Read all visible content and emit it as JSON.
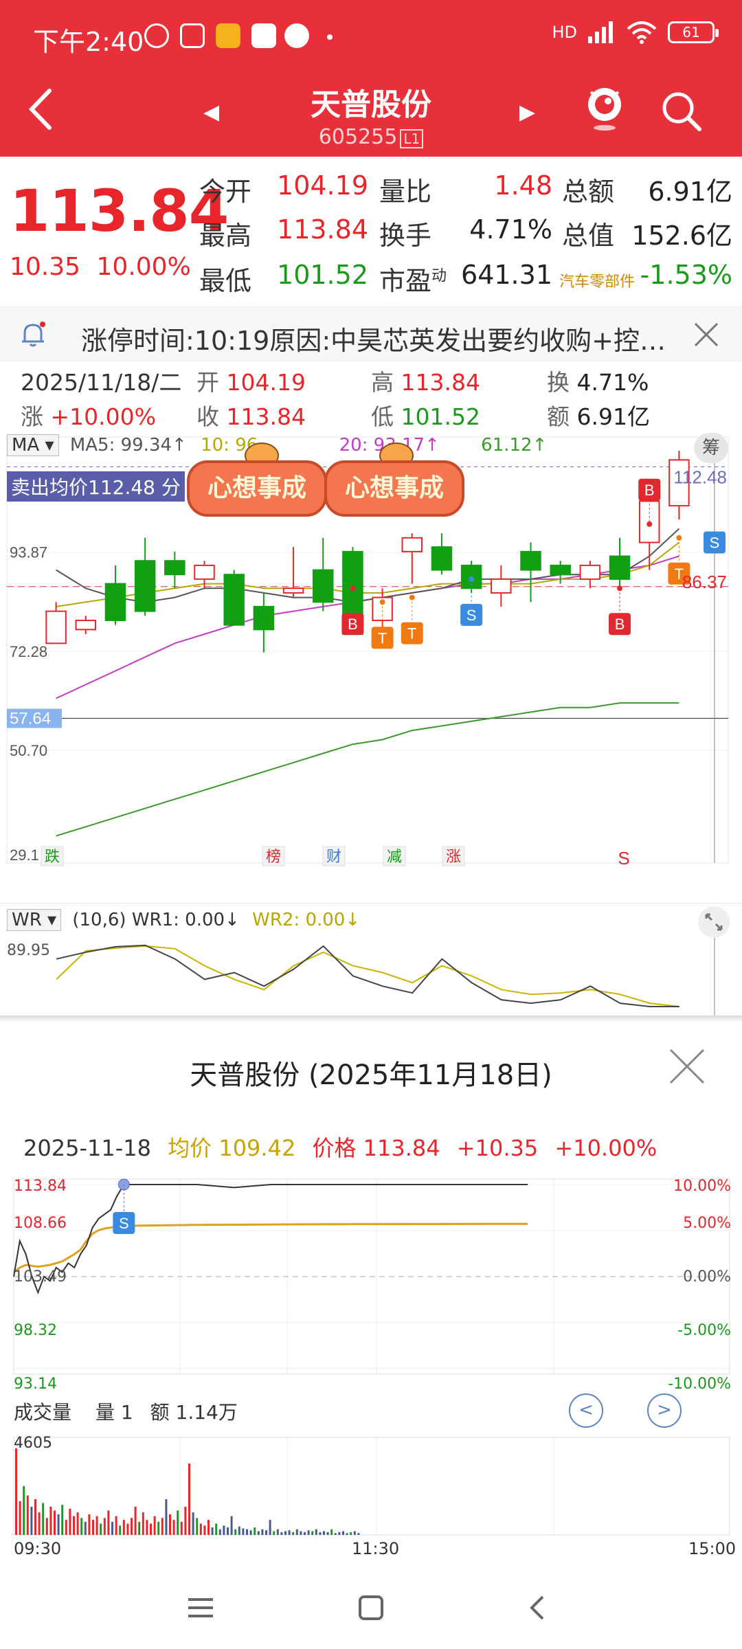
{
  "status": {
    "time": "下午2:40",
    "signal": "HD",
    "battery": "61"
  },
  "header": {
    "title": "天普股份",
    "code": "605255",
    "code_tag": "L1"
  },
  "quote": {
    "price": "113.84",
    "change": "10.35",
    "change_pct": "10.00%",
    "rows": [
      {
        "l1": "今开",
        "v1": "104.19",
        "l2": "量比",
        "v2": "1.48",
        "l3": "总额",
        "v3": "6.91亿"
      },
      {
        "l1": "最高",
        "v1": "113.84",
        "l2": "换手",
        "v2": "4.71%",
        "l3": "总值",
        "v3": "152.6亿"
      },
      {
        "l1": "最低",
        "v1": "101.52",
        "l2": "市盈",
        "l2_sup": "动",
        "v2": "641.31",
        "l3": "汽车零部件",
        "v3": "-1.53%"
      }
    ]
  },
  "notice": {
    "text": "涨停时间:10:19原因:中昊芯英发出要约收购+控…"
  },
  "day": {
    "date": "2025/11/18/二",
    "open_l": "开",
    "open_v": "104.19",
    "high_l": "高",
    "high_v": "113.84",
    "turn_l": "换",
    "turn_v": "4.71%",
    "chg_l": "涨",
    "chg_v": "+10.00%",
    "close_l": "收",
    "close_v": "113.84",
    "low_l": "低",
    "low_v": "101.52",
    "amt_l": "额",
    "amt_v": "6.91亿"
  },
  "kchart": {
    "indicator": "MA",
    "ma5": "MA5: 99.34↑",
    "ma10": "10: 96",
    "ma20": "20: 93.17↑",
    "ma60": "61.12↑",
    "chip_btn": "筹",
    "sell_avg": "卖出均价112.48 分",
    "sticker": "心想事成",
    "price_right": "112.48",
    "price_right2": "86.37",
    "axis": [
      "93.87",
      "72.28",
      "57.64",
      "50.70",
      "29.1"
    ],
    "events": [
      "跌",
      "榜",
      "财",
      "减",
      "涨",
      "S"
    ],
    "markers": {
      "B": "B",
      "T": "T",
      "S": "S"
    },
    "chart_data": {
      "type": "candlestick",
      "ylim": [
        29.1,
        116
      ],
      "candles": [
        {
          "o": 74,
          "c": 81,
          "h": 83,
          "l": 74
        },
        {
          "o": 77,
          "c": 79,
          "h": 80,
          "l": 76
        },
        {
          "o": 87,
          "c": 79,
          "h": 91,
          "l": 78
        },
        {
          "o": 92,
          "c": 81,
          "h": 97,
          "l": 80
        },
        {
          "o": 92,
          "c": 89,
          "h": 94,
          "l": 86
        },
        {
          "o": 88,
          "c": 91,
          "h": 92,
          "l": 86
        },
        {
          "o": 89,
          "c": 78,
          "h": 90,
          "l": 78
        },
        {
          "o": 82,
          "c": 77,
          "h": 85,
          "l": 72
        },
        {
          "o": 85,
          "c": 86,
          "h": 95,
          "l": 84
        },
        {
          "o": 90,
          "c": 83,
          "h": 97,
          "l": 81
        },
        {
          "o": 94,
          "c": 76,
          "h": 95,
          "l": 76
        },
        {
          "o": 79,
          "c": 84,
          "h": 86,
          "l": 76
        },
        {
          "o": 94,
          "c": 97,
          "h": 98,
          "l": 87
        },
        {
          "o": 95,
          "c": 90,
          "h": 98,
          "l": 89
        },
        {
          "o": 91,
          "c": 86,
          "h": 92,
          "l": 85
        },
        {
          "o": 85,
          "c": 88,
          "h": 91,
          "l": 82
        },
        {
          "o": 94,
          "c": 90,
          "h": 96,
          "l": 83
        },
        {
          "o": 91,
          "c": 89,
          "h": 92,
          "l": 87
        },
        {
          "o": 88,
          "c": 91,
          "h": 92,
          "l": 86
        },
        {
          "o": 93,
          "c": 88,
          "h": 97,
          "l": 86
        },
        {
          "o": 96,
          "c": 105,
          "h": 107,
          "l": 90
        },
        {
          "o": 104,
          "c": 114,
          "h": 116,
          "l": 101
        }
      ],
      "ma5": [
        90,
        86,
        84,
        83,
        84,
        86,
        86,
        85,
        84,
        84,
        83,
        84,
        85,
        86,
        88,
        88,
        88,
        89,
        89,
        89,
        93,
        99
      ],
      "ma10": [
        82,
        83,
        84,
        85,
        86,
        87,
        87,
        86,
        86,
        86,
        85,
        85,
        86,
        87,
        87,
        87,
        87,
        88,
        88,
        89,
        91,
        96
      ],
      "ma20": [
        62,
        65,
        68,
        71,
        74,
        76,
        78,
        80,
        81,
        82,
        83,
        84,
        85,
        86,
        87,
        87,
        88,
        88,
        89,
        90,
        91,
        93
      ],
      "ma60": [
        32,
        34,
        36,
        38,
        40,
        42,
        44,
        46,
        48,
        50,
        52,
        53,
        55,
        56,
        57,
        58,
        59,
        60,
        60,
        61,
        61,
        61
      ]
    }
  },
  "wr": {
    "indicator": "WR",
    "params": "(10,6)",
    "wr1": "WR1: 0.00↓",
    "wr2": "WR2: 0.00↓",
    "max": "89.95",
    "chart_data": {
      "type": "line",
      "wr1": [
        70,
        80,
        88,
        90,
        70,
        40,
        50,
        30,
        55,
        89,
        45,
        30,
        20,
        70,
        35,
        10,
        5,
        10,
        30,
        5,
        0,
        0
      ],
      "wr2": [
        40,
        82,
        86,
        89,
        85,
        60,
        40,
        25,
        60,
        80,
        60,
        50,
        35,
        60,
        45,
        25,
        18,
        20,
        25,
        18,
        5,
        0
      ]
    }
  },
  "sheet": {
    "title": "天普股份 (2025年11月18日)",
    "date": "2025-11-18",
    "avg_label": "均价",
    "avg_value": "109.42",
    "price_label": "价格",
    "price_value": "113.84",
    "change": "+10.35",
    "change_pct": "+10.00%",
    "left_ticks": [
      "113.84",
      "108.66",
      "103.49",
      "98.32",
      "93.14"
    ],
    "right_ticks": [
      "10.00%",
      "5.00%",
      "0.00%",
      "-5.00%",
      "-10.00%"
    ],
    "vol_label": "成交量",
    "qty_label": "量",
    "qty_value": "1",
    "amt_label": "额",
    "amt_value": "1.14万",
    "vol_max": "4605",
    "times": [
      "09:30",
      "11:30",
      "15:00"
    ],
    "marker_s": "S",
    "chart_data": {
      "type": "line",
      "ylim": [
        93.14,
        113.84
      ],
      "price": [
        103.5,
        107.5,
        106,
        103.5,
        101.7,
        103.5,
        103,
        104.5,
        104,
        105,
        104.5,
        106,
        107,
        109,
        110,
        110.5,
        111,
        112.5,
        113.84,
        113.84,
        113.84,
        113.5,
        113.84,
        113.84,
        113.84,
        113.84,
        113.84,
        113.84,
        113.84,
        113.84
      ],
      "avg": [
        104,
        104.5,
        104.8,
        104.7,
        104.6,
        104.7,
        104.8,
        105,
        105.2,
        105.6,
        106,
        106.5,
        107.5,
        108.3,
        108.7,
        108.9,
        109.0,
        109.1,
        109.2,
        109.25,
        109.3,
        109.32,
        109.35,
        109.37,
        109.38,
        109.39,
        109.4,
        109.41,
        109.42,
        109.42
      ],
      "volume": [
        4605,
        1800,
        2600,
        2100,
        1500,
        1900,
        1200,
        1700,
        900,
        1500,
        1300,
        1100,
        1600,
        800,
        1400,
        1000,
        1200,
        900,
        700,
        1100,
        800,
        1000,
        600,
        900,
        1300,
        700,
        1000,
        500,
        800,
        600,
        900,
        1500,
        700,
        1200,
        800,
        600,
        1000,
        700,
        900,
        1900,
        1100,
        800,
        1300,
        700,
        1500,
        3800,
        1200,
        900,
        600,
        500,
        800,
        400,
        600,
        300,
        500,
        400,
        1000,
        300,
        450,
        350,
        300,
        250,
        400,
        200,
        300,
        250,
        800,
        200,
        300,
        150,
        200,
        250,
        150,
        300,
        200,
        150,
        250,
        200,
        300,
        150,
        200,
        150,
        300,
        100,
        150,
        200,
        100,
        150,
        200,
        100
      ]
    }
  }
}
